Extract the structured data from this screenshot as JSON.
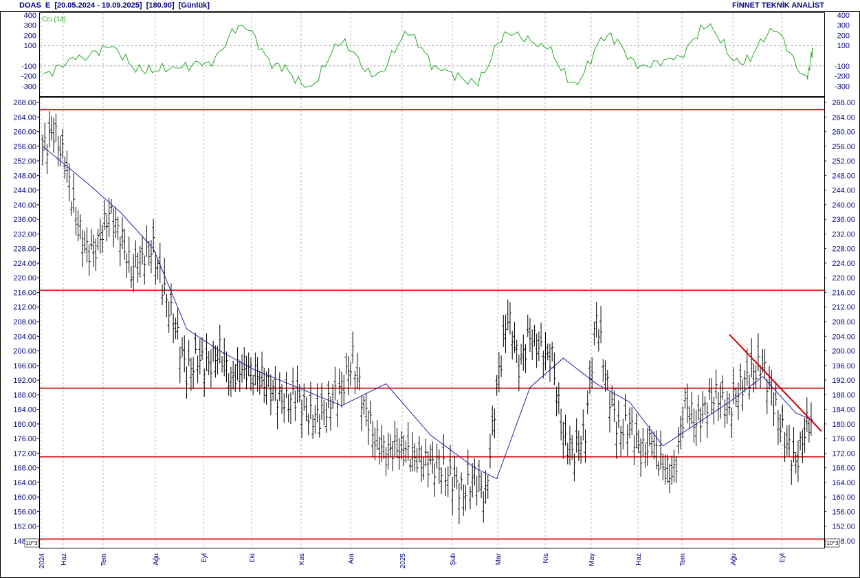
{
  "header": {
    "title": "DOAS  E  [20.05.2024 - 19.09.2025]  [180.90]  [Günlük]",
    "brand": "FİNNET TEKNİK ANALİST"
  },
  "indicator": {
    "name": "Cci (14)",
    "ticks": [
      "400",
      "300",
      "200",
      "100",
      "-100",
      "-200",
      "-300"
    ],
    "tick_values": [
      400,
      300,
      200,
      100,
      -100,
      -200,
      -300
    ],
    "reference_lines": [
      100,
      -100
    ],
    "color": "#22aa22"
  },
  "price_axis": {
    "ticks": [
      "268.00",
      "264.00",
      "260.00",
      "256.00",
      "252.00",
      "248.00",
      "244.00",
      "240.00",
      "236.00",
      "232.00",
      "228.00",
      "224.00",
      "220.00",
      "216.00",
      "212.00",
      "208.00",
      "204.00",
      "200.00",
      "196.00",
      "192.00",
      "188.00",
      "184.00",
      "180.00",
      "176.00",
      "172.00",
      "168.00",
      "164.00",
      "160.00",
      "156.00",
      "152.00",
      "148.00"
    ],
    "multiplier_label": "10^3"
  },
  "time_axis": {
    "labels": [
      "2024",
      "Haz",
      "Tem",
      "Ağu",
      "Eyl",
      "Eki",
      "Kas",
      "Ara",
      "2025",
      "Şub",
      "Mar",
      "Nis",
      "May",
      "Haz",
      "Tem",
      "Ağu",
      "Eyl"
    ]
  },
  "colors": {
    "bars": "#000000",
    "moving_average": "#2222aa",
    "levels": "#dd0000",
    "trend": "#cc0000",
    "axis_text": "#000080"
  },
  "chart_data": {
    "type": "ohlc",
    "ticker": "DOAS",
    "period": "20.05.2024 - 19.09.2025",
    "last_price": 180.9,
    "ylim": [
      148,
      268
    ],
    "horizontal_levels": [
      266.0,
      216.6,
      189.8,
      171.0,
      148.5
    ],
    "trendline": {
      "from": {
        "date": "2025-07-28",
        "price": 204.5
      },
      "to": {
        "date": "2025-09-19",
        "price": 178.0
      }
    },
    "close_series": {
      "dates": [
        "2024-05-20",
        "2024-05-27",
        "2024-06-03",
        "2024-06-10",
        "2024-06-17",
        "2024-06-24",
        "2024-07-01",
        "2024-07-08",
        "2024-07-15",
        "2024-07-22",
        "2024-07-29",
        "2024-08-05",
        "2024-08-12",
        "2024-08-19",
        "2024-08-26",
        "2024-09-02",
        "2024-09-09",
        "2024-09-16",
        "2024-09-23",
        "2024-09-30",
        "2024-10-07",
        "2024-10-14",
        "2024-10-21",
        "2024-10-28",
        "2024-11-04",
        "2024-11-11",
        "2024-11-18",
        "2024-11-25",
        "2024-12-02",
        "2024-12-09",
        "2024-12-16",
        "2024-12-23",
        "2024-12-30",
        "2025-01-06",
        "2025-01-13",
        "2025-01-20",
        "2025-01-27",
        "2025-02-03",
        "2025-02-10",
        "2025-02-17",
        "2025-02-24",
        "2025-03-03",
        "2025-03-10",
        "2025-03-17",
        "2025-03-24",
        "2025-03-31",
        "2025-04-07",
        "2025-04-14",
        "2025-04-21",
        "2025-04-28",
        "2025-05-05",
        "2025-05-12",
        "2025-05-19",
        "2025-05-26",
        "2025-06-02",
        "2025-06-09",
        "2025-06-16",
        "2025-06-23",
        "2025-06-30",
        "2025-07-07",
        "2025-07-14",
        "2025-07-21",
        "2025-07-28",
        "2025-08-04",
        "2025-08-11",
        "2025-08-18",
        "2025-08-25",
        "2025-09-01",
        "2025-09-08",
        "2025-09-15",
        "2025-09-19"
      ],
      "values": [
        255,
        260,
        252,
        236,
        227,
        229,
        238,
        232,
        222,
        226,
        228,
        216,
        206,
        194,
        198,
        196,
        200,
        192,
        196,
        194,
        192,
        188,
        186,
        188,
        182,
        182,
        186,
        190,
        198,
        185,
        176,
        172,
        174,
        172,
        170,
        169,
        168,
        165,
        161,
        166,
        160,
        190,
        210,
        196,
        204,
        200,
        198,
        176,
        172,
        178,
        210,
        190,
        178,
        180,
        172,
        175,
        168,
        166,
        186,
        180,
        186,
        188,
        184,
        190,
        194,
        196,
        186,
        176,
        169,
        180,
        180.9
      ]
    },
    "ma_series": {
      "dates": [
        "2024-05-20",
        "2024-06-17",
        "2024-07-08",
        "2024-07-29",
        "2024-08-19",
        "2024-09-09",
        "2024-09-30",
        "2024-10-28",
        "2024-11-25",
        "2024-12-23",
        "2025-01-20",
        "2025-02-17",
        "2025-03-03",
        "2025-03-24",
        "2025-04-14",
        "2025-05-05",
        "2025-05-26",
        "2025-06-16",
        "2025-07-07",
        "2025-07-28",
        "2025-08-18",
        "2025-09-08",
        "2025-09-19"
      ],
      "values": [
        256,
        246,
        238,
        228,
        206,
        200,
        195,
        190,
        185,
        191,
        177,
        168,
        165,
        190,
        198,
        191,
        186,
        174,
        180,
        186,
        193,
        183,
        181
      ]
    },
    "cci_series": {
      "dates": [
        "2024-05-20",
        "2024-06-10",
        "2024-07-01",
        "2024-07-22",
        "2024-08-12",
        "2024-09-02",
        "2024-09-23",
        "2024-10-14",
        "2024-11-04",
        "2024-11-25",
        "2024-12-16",
        "2025-01-06",
        "2025-01-27",
        "2025-02-17",
        "2025-03-10",
        "2025-03-31",
        "2025-04-21",
        "2025-05-12",
        "2025-06-02",
        "2025-06-23",
        "2025-07-14",
        "2025-08-04",
        "2025-08-25",
        "2025-09-15",
        "2025-09-19"
      ],
      "values": [
        -180,
        -40,
        80,
        -150,
        -120,
        -60,
        300,
        -80,
        -300,
        120,
        -200,
        200,
        -150,
        -260,
        220,
        120,
        -260,
        200,
        -100,
        -40,
        280,
        -80,
        240,
        -200,
        60
      ]
    }
  }
}
